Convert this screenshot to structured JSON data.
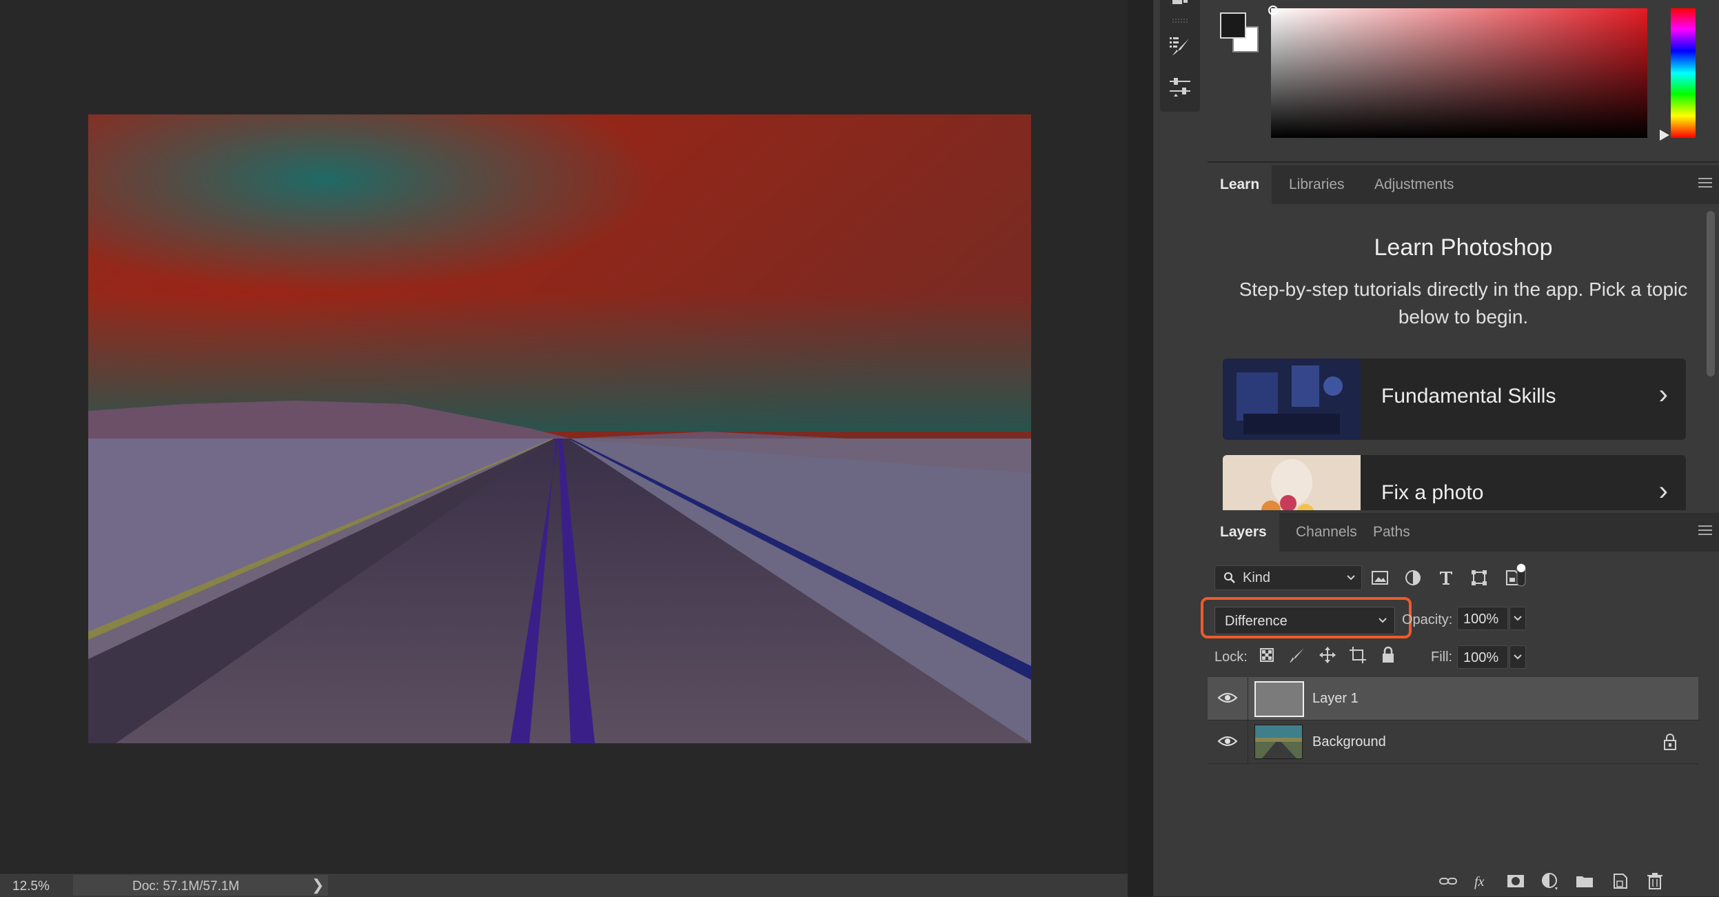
{
  "status_bar": {
    "zoom": "12.5%",
    "doc_size": "Doc: 57.1M/57.1M",
    "arrow": "❯"
  },
  "tools": [
    {
      "icon": "list-brush-icon"
    },
    {
      "icon": "sliders-icon"
    }
  ],
  "colors": {
    "foreground": "#1a1a1a",
    "background": "#ffffff",
    "field_hue": "#e31b23",
    "highlight": "#ee5a2a"
  },
  "learn_panel": {
    "tabs": [
      {
        "label": "Learn",
        "active": true
      },
      {
        "label": "Libraries",
        "active": false
      },
      {
        "label": "Adjustments",
        "active": false
      }
    ],
    "title": "Learn Photoshop",
    "description": "Step-by-step tutorials directly in the app. Pick a topic below to begin.",
    "cards": [
      {
        "title": "Fundamental Skills",
        "chevron": "›"
      },
      {
        "title": "Fix a photo",
        "chevron": "›"
      }
    ]
  },
  "layers_panel": {
    "tabs": [
      {
        "label": "Layers",
        "active": true
      },
      {
        "label": "Channels",
        "active": false
      },
      {
        "label": "Paths",
        "active": false
      }
    ],
    "filter_kind": "Kind",
    "blend_mode": "Difference",
    "opacity_label": "Opacity:",
    "opacity_value": "100%",
    "lock_label": "Lock:",
    "fill_label": "Fill:",
    "fill_value": "100%",
    "layers": [
      {
        "name": "Layer 1",
        "selected": true,
        "locked": false
      },
      {
        "name": "Background",
        "selected": false,
        "locked": true
      }
    ]
  }
}
